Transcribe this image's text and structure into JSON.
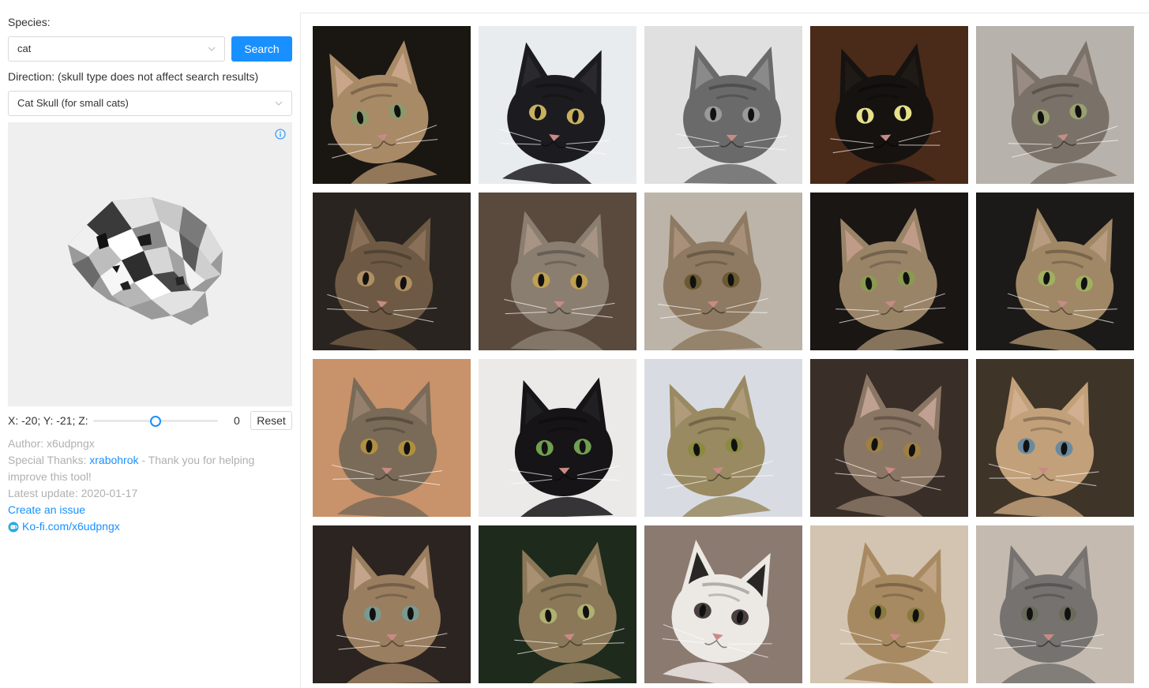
{
  "species": {
    "label": "Species:",
    "selected": "cat",
    "search_label": "Search"
  },
  "direction": {
    "label": "Direction: (skull type does not affect search results)",
    "selected": "Cat Skull (for small cats)"
  },
  "viewer": {
    "info_icon": "info-circle-icon"
  },
  "rotation": {
    "text": "X: -20; Y: -21; Z:",
    "value": "0",
    "slider_fraction": 0.5,
    "reset_label": "Reset"
  },
  "meta": {
    "author": "Author: x6udpngx",
    "thanks_prefix": "Special Thanks: ",
    "thanks_name": "xrabohrok",
    "thanks_suffix": " - Thank you for helping improve this tool!",
    "updated": "Latest update: 2020-01-17",
    "issue_link": "Create an issue",
    "kofi_link": "Ko-fi.com/x6udpngx"
  },
  "colors": {
    "accent": "#1890ff",
    "muted_text": "#b0b0b0",
    "viewer_bg": "#efefef"
  },
  "gallery": {
    "tiles": [
      {
        "fur": "#a88a66",
        "bg": "#1a1612",
        "ear": "#c9a58a",
        "eye": "#8a9a6a"
      },
      {
        "fur": "#1c1c20",
        "bg": "#e8ecef",
        "ear": "#2a2a2e",
        "eye": "#c8b060"
      },
      {
        "fur": "#6a6a6a",
        "bg": "#e0e0e0",
        "ear": "#8a8a8a",
        "eye": "#9a9a9a"
      },
      {
        "fur": "#151210",
        "bg": "#4a2a18",
        "ear": "#201a16",
        "eye": "#e8e08a"
      },
      {
        "fur": "#7a7268",
        "bg": "#b8b2ac",
        "ear": "#9a8c84",
        "eye": "#9aa070"
      },
      {
        "fur": "#6e5a44",
        "bg": "#2a2420",
        "ear": "#8a7058",
        "eye": "#b09060"
      },
      {
        "fur": "#8a7e70",
        "bg": "#5a4a3e",
        "ear": "#a89484",
        "eye": "#c0a050"
      },
      {
        "fur": "#8e7a62",
        "bg": "#bcb4a8",
        "ear": "#a8907a",
        "eye": "#6a5a30"
      },
      {
        "fur": "#9a8468",
        "bg": "#1a1614",
        "ear": "#c09c88",
        "eye": "#8a9a50"
      },
      {
        "fur": "#a08866",
        "bg": "#1c1a18",
        "ear": "#b89c80",
        "eye": "#a0b060"
      },
      {
        "fur": "#7a6a58",
        "bg": "#c8926a",
        "ear": "#94806c",
        "eye": "#b09040"
      },
      {
        "fur": "#161416",
        "bg": "#eceae8",
        "ear": "#202022",
        "eye": "#70a050"
      },
      {
        "fur": "#9a8a62",
        "bg": "#d8dce2",
        "ear": "#b09c7a",
        "eye": "#8a8a40"
      },
      {
        "fur": "#8a7664",
        "bg": "#3a2e28",
        "ear": "#c0a090",
        "eye": "#a08040"
      },
      {
        "fur": "#c2a07a",
        "bg": "#3e3428",
        "ear": "#d0b090",
        "eye": "#6a8aa0"
      },
      {
        "fur": "#9a7e60",
        "bg": "#2c2420",
        "ear": "#c4a48a",
        "eye": "#7a9a90"
      },
      {
        "fur": "#8a7858",
        "bg": "#1e2a1c",
        "ear": "#a89070",
        "eye": "#b0b070"
      },
      {
        "fur": "#ece8e4",
        "bg": "#8a7a70",
        "ear": "#2a2626",
        "eye": "#4a4040"
      },
      {
        "fur": "#a88a62",
        "bg": "#d2c4b0",
        "ear": "#c0a484",
        "eye": "#8a7a40"
      },
      {
        "fur": "#767270",
        "bg": "#c4bab0",
        "ear": "#8e8884",
        "eye": "#6a6a5a"
      }
    ]
  }
}
